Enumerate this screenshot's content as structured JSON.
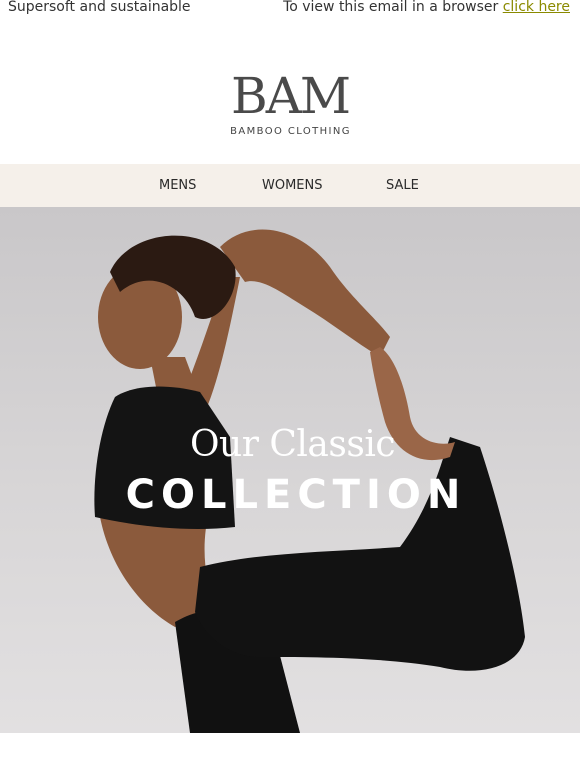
{
  "preheader": {
    "left_text": "Supersoft and sustainable",
    "right_text": "To view this email in a browser",
    "link_text": "click here"
  },
  "logo": {
    "wordmark": "BAM",
    "subtitle": "BAMBOO CLOTHING"
  },
  "nav": {
    "items": [
      {
        "label": "MENS"
      },
      {
        "label": "WOMENS"
      },
      {
        "label": "SALE"
      }
    ]
  },
  "hero": {
    "line1": "Our Classic",
    "line2": "COLLECTION"
  },
  "colors": {
    "nav_background": "#f5f0ea",
    "link": "#8a8a00",
    "hero_background": "#d3d1d2"
  }
}
